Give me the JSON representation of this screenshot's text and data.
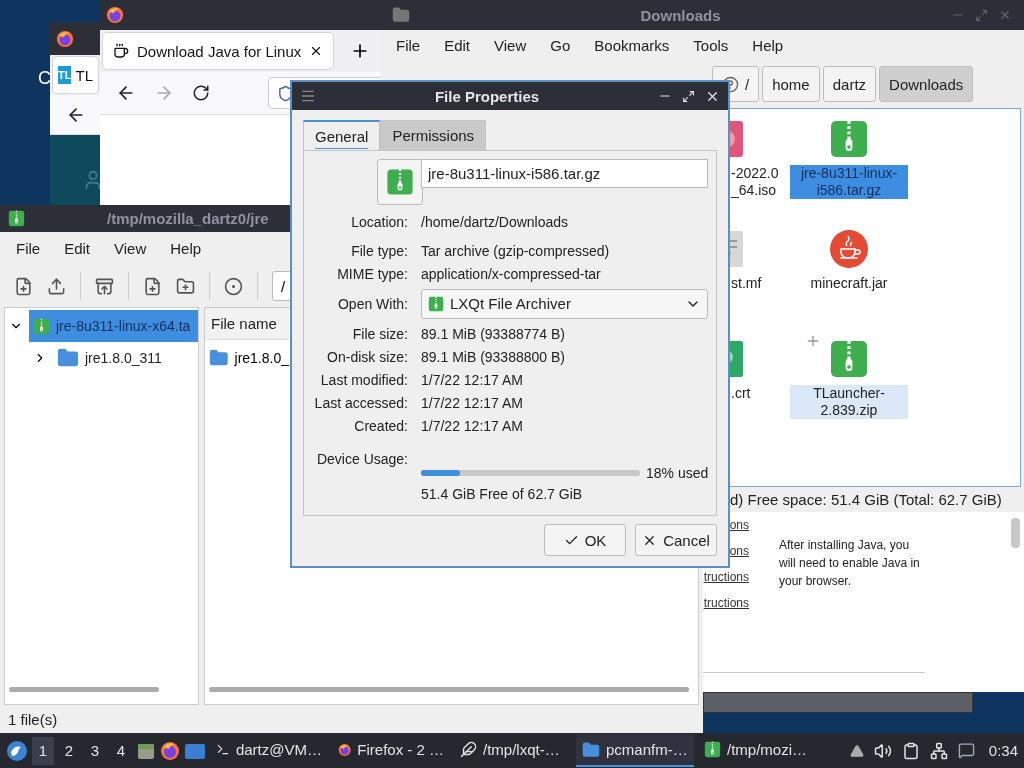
{
  "desktop": {
    "text": "C"
  },
  "back_browser": {
    "tabs": [
      {
        "icon_text": "TL",
        "label": "TL",
        "selected": true
      }
    ]
  },
  "browser": {
    "tabs": [
      {
        "label": "Download Java for Linux",
        "selected": true
      }
    ],
    "page": {
      "links": [
        "ons",
        "ons",
        "tructions",
        "tructions"
      ],
      "paragraph": "After installing Java, you will need to enable Java in your browser."
    }
  },
  "file_manager": {
    "title": "Downloads",
    "menu": [
      "File",
      "Edit",
      "View",
      "Go",
      "Bookmarks",
      "Tools",
      "Help"
    ],
    "path": [
      {
        "label": "/",
        "selected": false
      },
      {
        "label": "home",
        "selected": false
      },
      {
        "label": "dartz",
        "selected": false
      },
      {
        "label": "Downloads",
        "selected": true
      }
    ],
    "items": [
      {
        "kind": "disc-image",
        "label": "-2022.0 _64.iso",
        "selected": false,
        "hovered": false
      },
      {
        "kind": "archive",
        "label": "jre-8u311-linux-i586.tar.gz",
        "selected": true,
        "hovered": false
      },
      {
        "kind": "manifest",
        "label": "st.mf",
        "selected": false,
        "hovered": false
      },
      {
        "kind": "jar",
        "label": "minecraft.jar",
        "selected": false,
        "hovered": false
      },
      {
        "kind": "certificate",
        "label": ".crt",
        "selected": false,
        "hovered": false
      },
      {
        "kind": "archive",
        "label": "TLauncher-2.839.zip",
        "selected": false,
        "hovered": true
      }
    ],
    "status": "d)   Free space: 51.4 GiB (Total: 62.7 GiB)"
  },
  "archiver": {
    "title": "/tmp/mozilla_dartz0/jre",
    "menu": [
      "File",
      "Edit",
      "View",
      "Help"
    ],
    "path": "/",
    "tree": [
      {
        "label": "jre-8u311-linux-x64.ta",
        "kind": "archive",
        "selected": true,
        "expanded": true,
        "children": [
          {
            "label": "jre1.8.0_311",
            "kind": "folder",
            "selected": false,
            "expanded": false
          }
        ]
      }
    ],
    "columns": [
      "File name"
    ],
    "rows": [
      {
        "name": "jre1.8.0_"
      }
    ],
    "status": "1 file(s)"
  },
  "dialog": {
    "title": "File Properties",
    "tabs": [
      {
        "label": "General",
        "selected": true
      },
      {
        "label": "Permissions",
        "selected": false
      }
    ],
    "name": "jre-8u311-linux-i586.tar.gz",
    "fields": [
      {
        "kind": "text",
        "label": "Location:",
        "value": "/home/dartz/Downloads"
      },
      {
        "kind": "text",
        "label": "File type:",
        "value": "Tar archive (gzip-compressed)"
      },
      {
        "kind": "text",
        "label": "MIME type:",
        "value": "application/x-compressed-tar"
      },
      {
        "kind": "select",
        "label": "Open With:",
        "value": "LXQt File Archiver"
      },
      {
        "kind": "text",
        "label": "File size:",
        "value": "89.1 MiB (93388774 B)"
      },
      {
        "kind": "text",
        "label": "On-disk size:",
        "value": "89.1 MiB (93388800 B)"
      },
      {
        "kind": "text",
        "label": "Last modified:",
        "value": "1/7/22 12:17 AM"
      },
      {
        "kind": "text",
        "label": "Last accessed:",
        "value": "1/7/22 12:17 AM"
      },
      {
        "kind": "text",
        "label": "Created:",
        "value": "1/7/22 12:17 AM"
      }
    ],
    "usage": {
      "label": "Device Usage:",
      "level": 0.18,
      "reading": "18% used",
      "detail": "51.4 GiB Free of 62.7 GiB"
    },
    "buttons": [
      {
        "kind": "ok",
        "label": "OK"
      },
      {
        "kind": "cancel",
        "label": "Cancel"
      }
    ]
  },
  "taskbar": {
    "desktops": [
      {
        "label": "1",
        "selected": true
      },
      {
        "label": "2",
        "selected": false
      },
      {
        "label": "3",
        "selected": false
      },
      {
        "label": "4",
        "selected": false
      }
    ],
    "tasks": [
      {
        "kind": "terminal",
        "label": "dartz@VM…",
        "selected": false
      },
      {
        "kind": "browser",
        "label": "Firefox - 2 …",
        "selected": false
      },
      {
        "kind": "feather",
        "label": "/tmp/lxqt-…",
        "selected": false
      },
      {
        "kind": "folder",
        "label": "pcmanfm-…",
        "selected": true
      },
      {
        "kind": "archive",
        "label": "/tmp/mozi…",
        "selected": false
      }
    ],
    "clock": "0:34"
  }
}
